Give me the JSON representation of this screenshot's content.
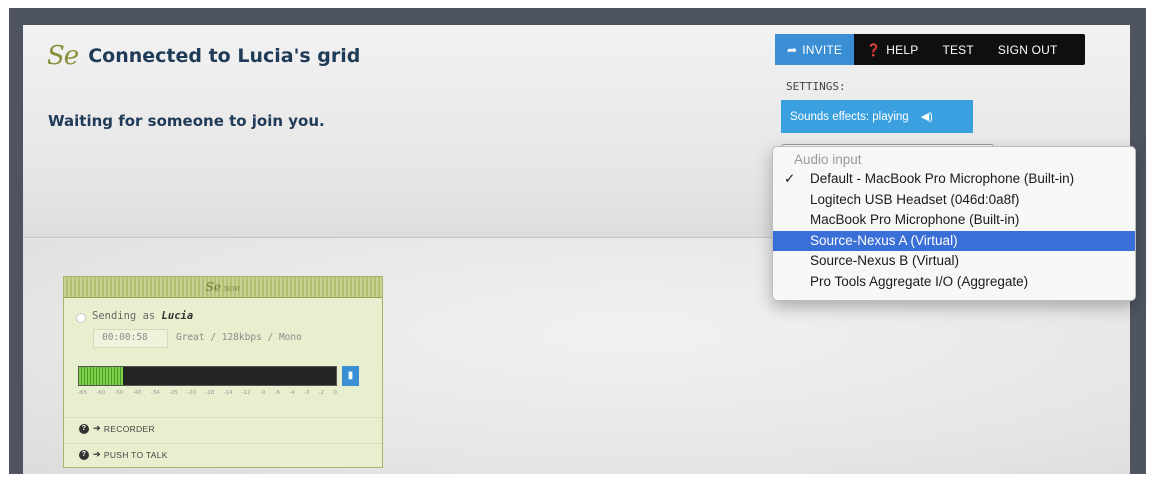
{
  "header": {
    "logo": "Se",
    "title": "Connected to Lucia's grid",
    "status": "Waiting for someone to join you."
  },
  "nav": {
    "items": [
      {
        "label": "INVITE",
        "icon": "share-arrow-icon",
        "glyph": "➦"
      },
      {
        "label": "HELP",
        "icon": "help-icon",
        "glyph": "❓"
      },
      {
        "label": "TEST",
        "icon": "",
        "glyph": ""
      },
      {
        "label": "SIGN OUT",
        "icon": "",
        "glyph": ""
      }
    ],
    "accent": "#3a8fd4"
  },
  "settings": {
    "label": "SETTINGS:",
    "sounds_button": "Sounds effects: playing",
    "sounds_icon": "speaker-icon"
  },
  "audio_menu": {
    "header": "Audio input",
    "checked_index": 0,
    "selected_index": 3,
    "items": [
      "Default - MacBook Pro Microphone (Built-in)",
      "Logitech USB Headset (046d:0a8f)",
      "MacBook Pro Microphone (Built-in)",
      "Source-Nexus A (Virtual)",
      "Source-Nexus B (Virtual)",
      "Pro Tools Aggregate I/O (Aggregate)"
    ],
    "selected_color": "#3a6fd8"
  },
  "widget": {
    "logo": "Se",
    "logo_tag": "NOW",
    "sending_prefix": "Sending as",
    "sending_user": "Lucia",
    "timer": "00:00:58",
    "quality": "Great / 128kbps / Mono",
    "meter_level": 0.17,
    "meter_scale": [
      "-65",
      "-60",
      "-50",
      "-40",
      "-34",
      "-25",
      "-20",
      "-18",
      "-14",
      "-12",
      "-9",
      "-6",
      "-4",
      "-3",
      "-2",
      "0"
    ],
    "rows": [
      {
        "label": "RECORDER"
      },
      {
        "label": "PUSH TO TALK"
      }
    ]
  }
}
